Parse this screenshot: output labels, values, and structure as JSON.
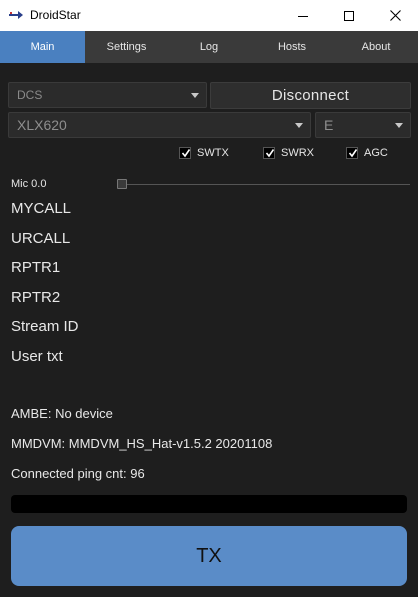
{
  "window": {
    "title": "DroidStar"
  },
  "tabs": [
    {
      "label": "Main",
      "active": true
    },
    {
      "label": "Settings",
      "active": false
    },
    {
      "label": "Log",
      "active": false
    },
    {
      "label": "Hosts",
      "active": false
    },
    {
      "label": "About",
      "active": false
    }
  ],
  "controls": {
    "mode_select": "DCS",
    "connect_button": "Disconnect",
    "host_select": "XLX620",
    "module_select": "E"
  },
  "checkboxes": [
    {
      "label": "SWTX",
      "checked": true
    },
    {
      "label": "SWRX",
      "checked": true
    },
    {
      "label": "AGC",
      "checked": true
    }
  ],
  "mic": {
    "label": "Mic 0.0",
    "level": 0.0
  },
  "fields": [
    "MYCALL",
    "URCALL",
    "RPTR1",
    "RPTR2",
    "Stream ID",
    "User txt"
  ],
  "status": {
    "ambe": "AMBE: No device",
    "mmdvm": "MMDVM: MMDVM_HS_Hat-v1.5.2 20201108",
    "ping": "Connected ping cnt: 96"
  },
  "progress": {
    "level": 0.0
  },
  "tx_button": "TX",
  "colors": {
    "accent": "#4a80c0",
    "tx": "#5a8cc8",
    "background": "#1e1e1e"
  },
  "icons": [
    "app-icon",
    "minimize-icon",
    "maximize-icon",
    "close-icon",
    "chevron-down-icon",
    "checkmark-icon"
  ]
}
